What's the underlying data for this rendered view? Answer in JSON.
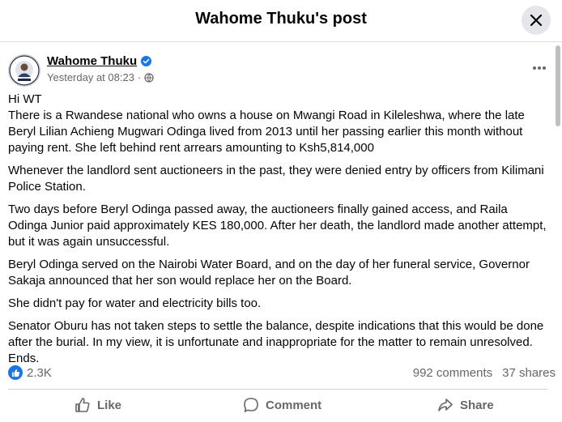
{
  "header": {
    "title": "Wahome Thuku's post"
  },
  "post": {
    "author": "Wahome Thuku",
    "avatar_text_top": "WAHOME THUKU",
    "avatar_text_bottom": "MEDIA",
    "timestamp": "Yesterday at 08:23",
    "separator": "·",
    "paragraphs": [
      "Hi WT",
      "There is a Rwandese national who owns a house on Mwangi Road in Kileleshwa, where the late Beryl Lilian Achieng Mugwari Odinga lived from 2013 until her passing earlier this month without paying rent. She left behind rent arrears amounting to Ksh5,814,000",
      "Whenever the landlord sent auctioneers in the past, they were denied entry by officers from Kilimani Police Station.",
      "Two days before Beryl Odinga passed away, the auctioneers finally gained access, and Raila Odinga Junior paid approximately KES 180,000. After her death, the landlord made another attempt, but it was again unsuccessful.",
      "Beryl Odinga served on the Nairobi Water Board, and on the day of her funeral service, Governor Sakaja announced that her son would replace her on the Board.",
      "She didn't pay for water and electricity bills too.",
      "Senator Oburu has not taken steps to settle the balance, despite indications that this would be done after the burial. In my view, it is unfortunate and inappropriate for the matter to remain unresolved.",
      "Ends."
    ],
    "reactions_count": "2.3K",
    "comments_count": "992 comments",
    "shares_count": "37 shares"
  },
  "actions": {
    "like": "Like",
    "comment": "Comment",
    "share": "Share"
  },
  "colors": {
    "accent": "#1b74e4",
    "secondary_text": "#65676b"
  },
  "icons": {
    "close": "close-icon",
    "verified": "verified-badge-icon",
    "globe": "globe-icon",
    "more": "more-icon",
    "like": "thumbs-up-icon",
    "comment": "comment-bubble-icon",
    "share": "share-arrow-icon"
  }
}
